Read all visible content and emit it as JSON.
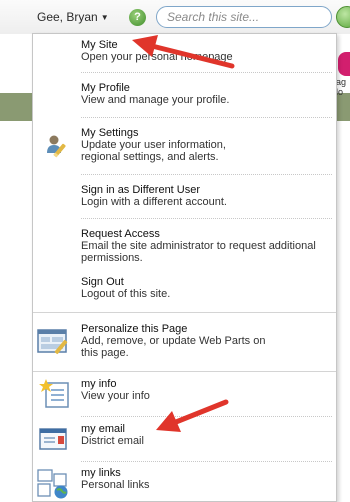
{
  "header": {
    "user_name": "Gee, Bryan",
    "help_label": "?",
    "search_placeholder": "Search this site..."
  },
  "background": {
    "peek_text_1": "ag",
    "peek_text_2": "lo"
  },
  "menu": {
    "items": [
      {
        "title": "My Site",
        "desc": "Open your personal homepage"
      },
      {
        "title": "My Profile",
        "desc": "View and manage your profile."
      },
      {
        "title": "My Settings",
        "desc": "Update your user information, regional settings, and alerts."
      },
      {
        "title": "Sign in as Different User",
        "desc": "Login with a different account."
      },
      {
        "title": "Request Access",
        "desc": "Email the site administrator to request additional permissions."
      },
      {
        "title": "Sign Out",
        "desc": "Logout of this site."
      },
      {
        "title": "Personalize this Page",
        "desc": "Add, remove, or update Web Parts on this page."
      },
      {
        "title": "my info",
        "desc": "View your info"
      },
      {
        "title": "my email",
        "desc": "District email"
      },
      {
        "title": "my links",
        "desc": "Personal links"
      }
    ]
  },
  "colors": {
    "arrow": "#e0352b",
    "accent_green": "#3f8d2a",
    "search_border": "#7fa6c9"
  },
  "icons": {
    "settings": "user-pencil-icon",
    "personalize": "page-edit-icon",
    "info": "info-page-icon",
    "email": "email-envelope-icon",
    "links": "links-globe-icon"
  }
}
